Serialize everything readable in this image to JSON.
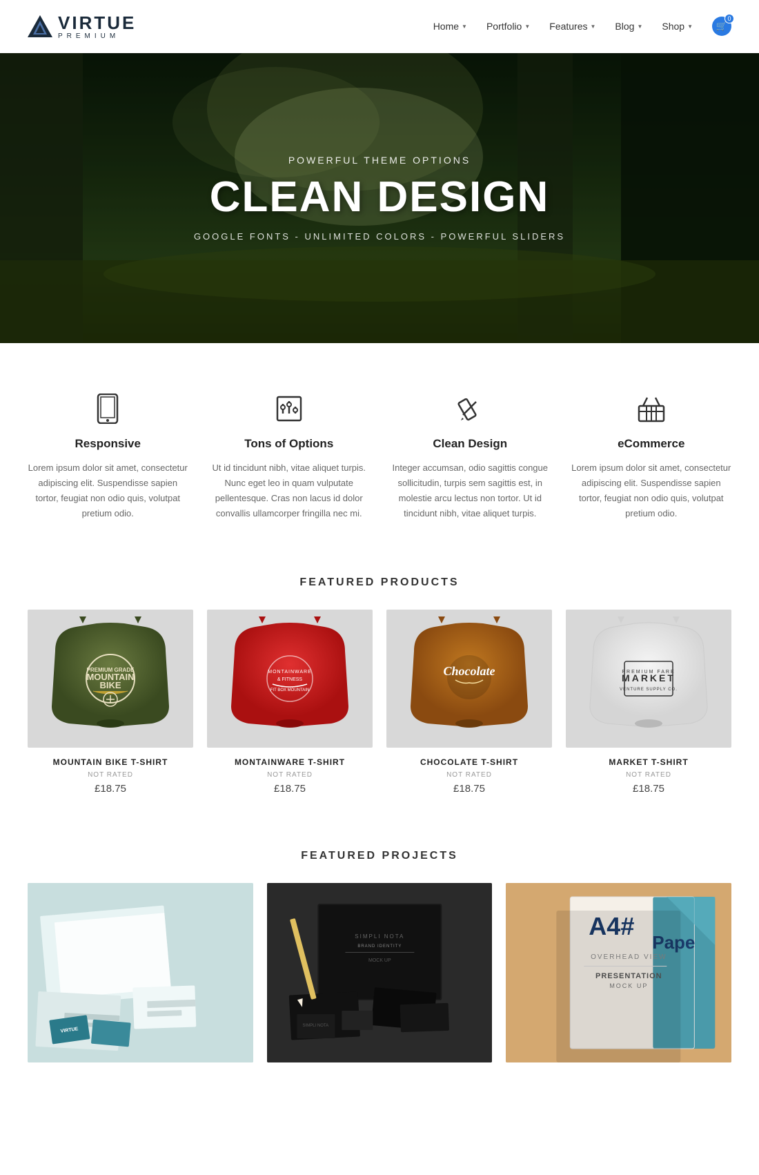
{
  "brand": {
    "name": "VIRTUE",
    "sub": "PREMIUM",
    "logo_triangle_color": "#2a3b5c"
  },
  "nav": {
    "items": [
      {
        "label": "Home",
        "has_dropdown": true
      },
      {
        "label": "Portfolio",
        "has_dropdown": true
      },
      {
        "label": "Features",
        "has_dropdown": true
      },
      {
        "label": "Blog",
        "has_dropdown": true
      },
      {
        "label": "Shop",
        "has_dropdown": true
      }
    ],
    "cart_count": "0"
  },
  "hero": {
    "subtitle": "POWERFUL THEME OPTIONS",
    "title": "CLEAN DESIGN",
    "tagline": "GOOGLE FONTS - UNLIMITED COLORS - POWERFUL SLIDERS"
  },
  "features": [
    {
      "icon": "mobile",
      "title": "Responsive",
      "desc": "Lorem ipsum dolor sit amet, consectetur adipiscing elit. Suspendisse sapien tortor, feugiat non odio quis, volutpat pretium odio."
    },
    {
      "icon": "sliders",
      "title": "Tons of Options",
      "desc": "Ut id tincidunt nibh, vitae aliquet turpis. Nunc eget leo in quam vulputate pellentesque. Cras non lacus id dolor convallis ullamcorper fringilla nec mi."
    },
    {
      "icon": "pencil",
      "title": "Clean Design",
      "desc": "Integer accumsan, odio sagittis congue sollicitudin, turpis sem sagittis est, in molestie arcu lectus non tortor. Ut id tincidunt nibh, vitae aliquet turpis."
    },
    {
      "icon": "basket",
      "title": "eCommerce",
      "desc": "Lorem ipsum dolor sit amet, consectetur adipiscing elit. Suspendisse sapien tortor, feugiat non odio quis, volutpat pretium odio."
    }
  ],
  "products_section": {
    "title": "FEATURED PRODUCTS",
    "products": [
      {
        "name": "MOUNTAIN BIKE T-SHIRT",
        "rating": "NOT RATED",
        "price": "£18.75",
        "color": "green"
      },
      {
        "name": "MONTAINWARE T-SHIRT",
        "rating": "NOT RATED",
        "price": "£18.75",
        "color": "red"
      },
      {
        "name": "CHOCOLATE T-SHIRT",
        "rating": "NOT RATED",
        "price": "£18.75",
        "color": "brown"
      },
      {
        "name": "MARKET T-SHIRT",
        "rating": "NOT RATED",
        "price": "£18.75",
        "color": "white"
      }
    ]
  },
  "projects_section": {
    "title": "FEATURED PROJECTS",
    "projects": [
      {
        "theme": "teal",
        "label": "Stationery Mockup"
      },
      {
        "theme": "dark",
        "label": "Brand Identity"
      },
      {
        "theme": "warm",
        "label": "Paper Presentation"
      }
    ]
  }
}
